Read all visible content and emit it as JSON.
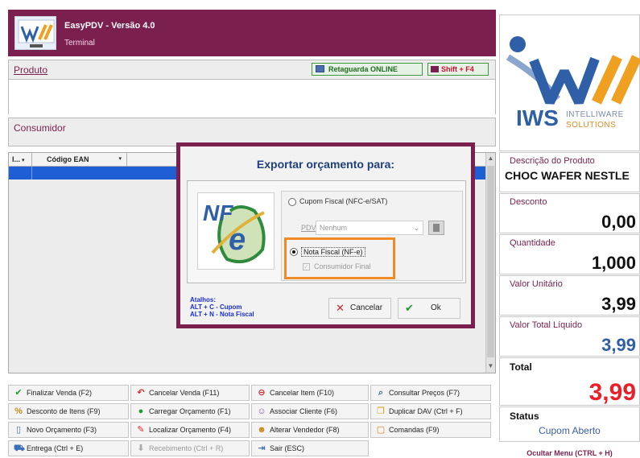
{
  "app": {
    "title": "EasyPDV - Versão 4.0",
    "subtitle": "Terminal"
  },
  "produto": {
    "label": "Produto",
    "value": "",
    "retaguarda": "Retaguarda ONLINE",
    "shortcut": "Shift + F4"
  },
  "consumidor": {
    "label": "Consumidor"
  },
  "grid": {
    "columns": [
      "I...",
      "Código EAN"
    ]
  },
  "dialog": {
    "title": "Exportar orçamento para:",
    "option_cupom": "Cupom Fiscal (NFC-e/SAT)",
    "pdv_label": "PDV",
    "pdv_value": "Nenhum",
    "option_nota": "Nota Fiscal (NF-e)",
    "consumidor_final": "Consumidor Final",
    "selected": "nota",
    "shortcuts_title": "Atalhos:",
    "shortcut_1": "ALT + C - Cupom",
    "shortcut_2": "ALT + N - Nota Fiscal",
    "cancel_label": "Cancelar",
    "ok_label": "Ok"
  },
  "buttons": [
    {
      "label": "Finalizar Venda (F2)",
      "icon": "check-icon"
    },
    {
      "label": "Cancelar Venda (F11)",
      "icon": "cancel-sale-icon"
    },
    {
      "label": "Cancelar Item (F10)",
      "icon": "cancel-item-icon"
    },
    {
      "label": "Consultar Preços (F7)",
      "icon": "search-icon"
    },
    {
      "label": "Desconto de Itens (F9)",
      "icon": "discount-icon"
    },
    {
      "label": "Carregar Orçamento (F1)",
      "icon": "load-icon"
    },
    {
      "label": "Associar Cliente (F6)",
      "icon": "client-icon"
    },
    {
      "label": "Duplicar DAV (Ctrl + F)",
      "icon": "duplicate-icon"
    },
    {
      "label": "Novo Orçamento (F3)",
      "icon": "new-doc-icon"
    },
    {
      "label": "Localizar Orçamento (F4)",
      "icon": "locate-icon"
    },
    {
      "label": "Alterar Vendedor (F8)",
      "icon": "seller-icon"
    },
    {
      "label": "Comandas (F9)",
      "icon": "comandas-icon"
    },
    {
      "label": "Entrega (Ctrl + E)",
      "icon": "truck-icon"
    },
    {
      "label": "Recebimento (Ctrl + R)",
      "icon": "receive-icon"
    },
    {
      "label": "Sair (ESC)",
      "icon": "exit-icon"
    }
  ],
  "right_panel": {
    "logo_text": "IWS",
    "logo_sub1": "INTELLIWARE",
    "logo_sub2": "SOLUTIONS",
    "descricao_label": "Descrição do Produto",
    "descricao_value": "CHOC WAFER NESTLE",
    "desconto_label": "Desconto",
    "desconto_value": "0,00",
    "quantidade_label": "Quantidade",
    "quantidade_value": "1,000",
    "unitario_label": "Valor Unitário",
    "unitario_value": "3,99",
    "liquido_label": "Valor Total Líquido",
    "liquido_value": "3,99",
    "total_label": "Total",
    "total_value": "3,99",
    "status_label": "Status",
    "status_value": "Cupom Aberto",
    "ocultar": "Ocultar Menu (CTRL + H)"
  },
  "colors": {
    "brand": "#7b1f4f",
    "total": "#e8202a",
    "highlight": "#f08a24",
    "accent_blue": "#3b5fa8"
  }
}
